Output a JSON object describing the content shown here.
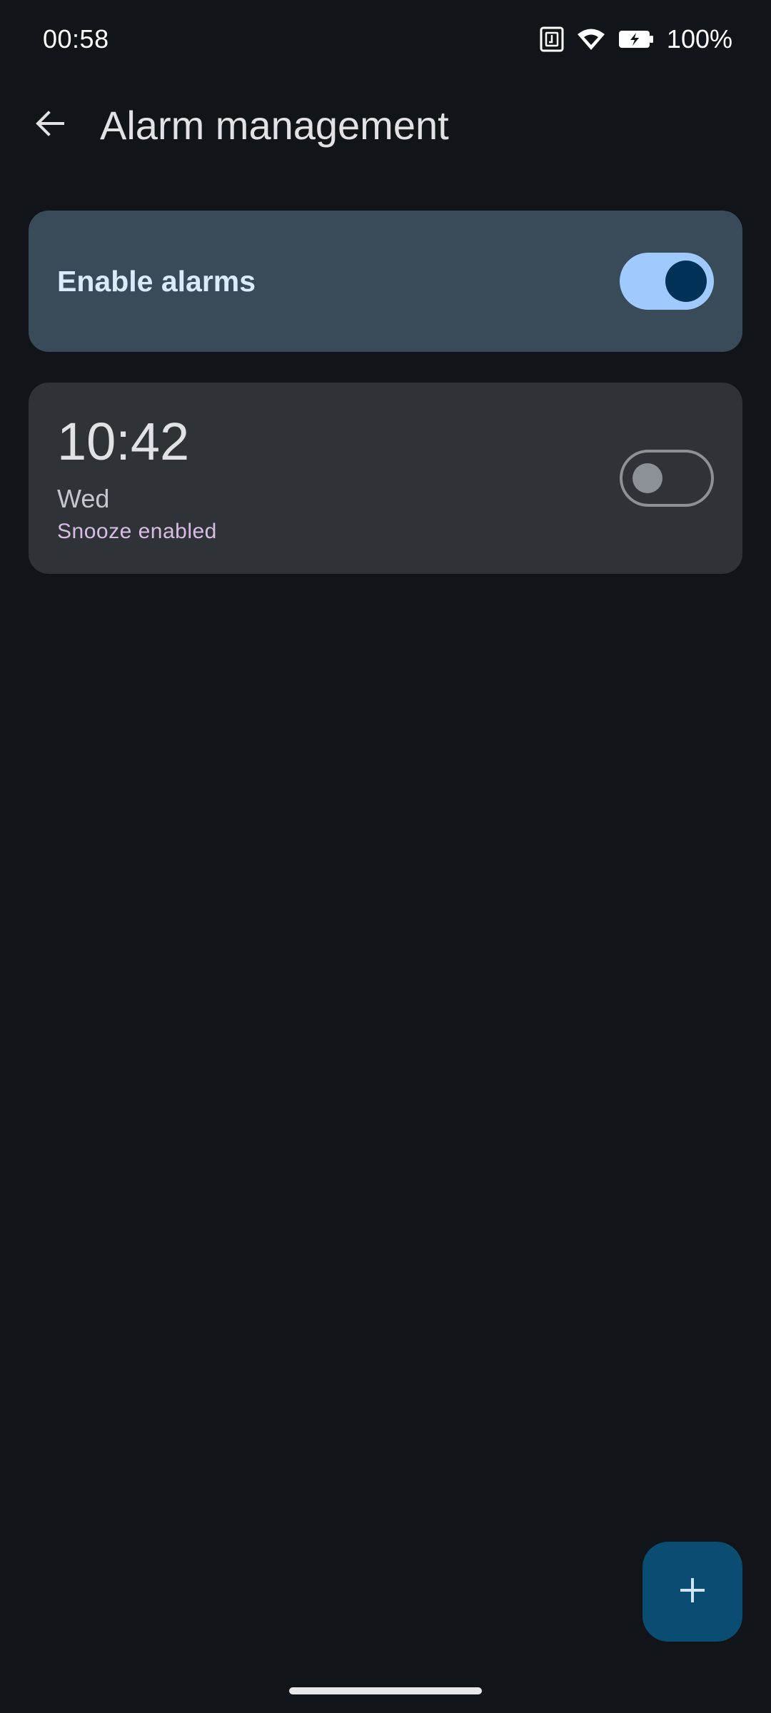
{
  "status_bar": {
    "time": "00:58",
    "battery_percent": "100%",
    "icons": [
      "nfc-icon",
      "wifi-icon",
      "battery-charging-icon"
    ]
  },
  "app_bar": {
    "title": "Alarm management",
    "back_icon": "arrow-back-icon"
  },
  "master_toggle": {
    "label": "Enable alarms",
    "checked": true
  },
  "alarms": [
    {
      "time": "10:42",
      "days": "Wed",
      "snooze": "Snooze enabled",
      "enabled": false
    }
  ],
  "fab": {
    "icon": "add-icon"
  },
  "colors": {
    "background": "#111418",
    "master_card": "#394b59",
    "alarm_card": "#2f3237",
    "switch_on_track": "#a0cafd",
    "switch_on_thumb": "#003258",
    "switch_off_outline": "#8c9198",
    "snooze_text": "#d7bde4",
    "fab": "#0b4c73"
  }
}
